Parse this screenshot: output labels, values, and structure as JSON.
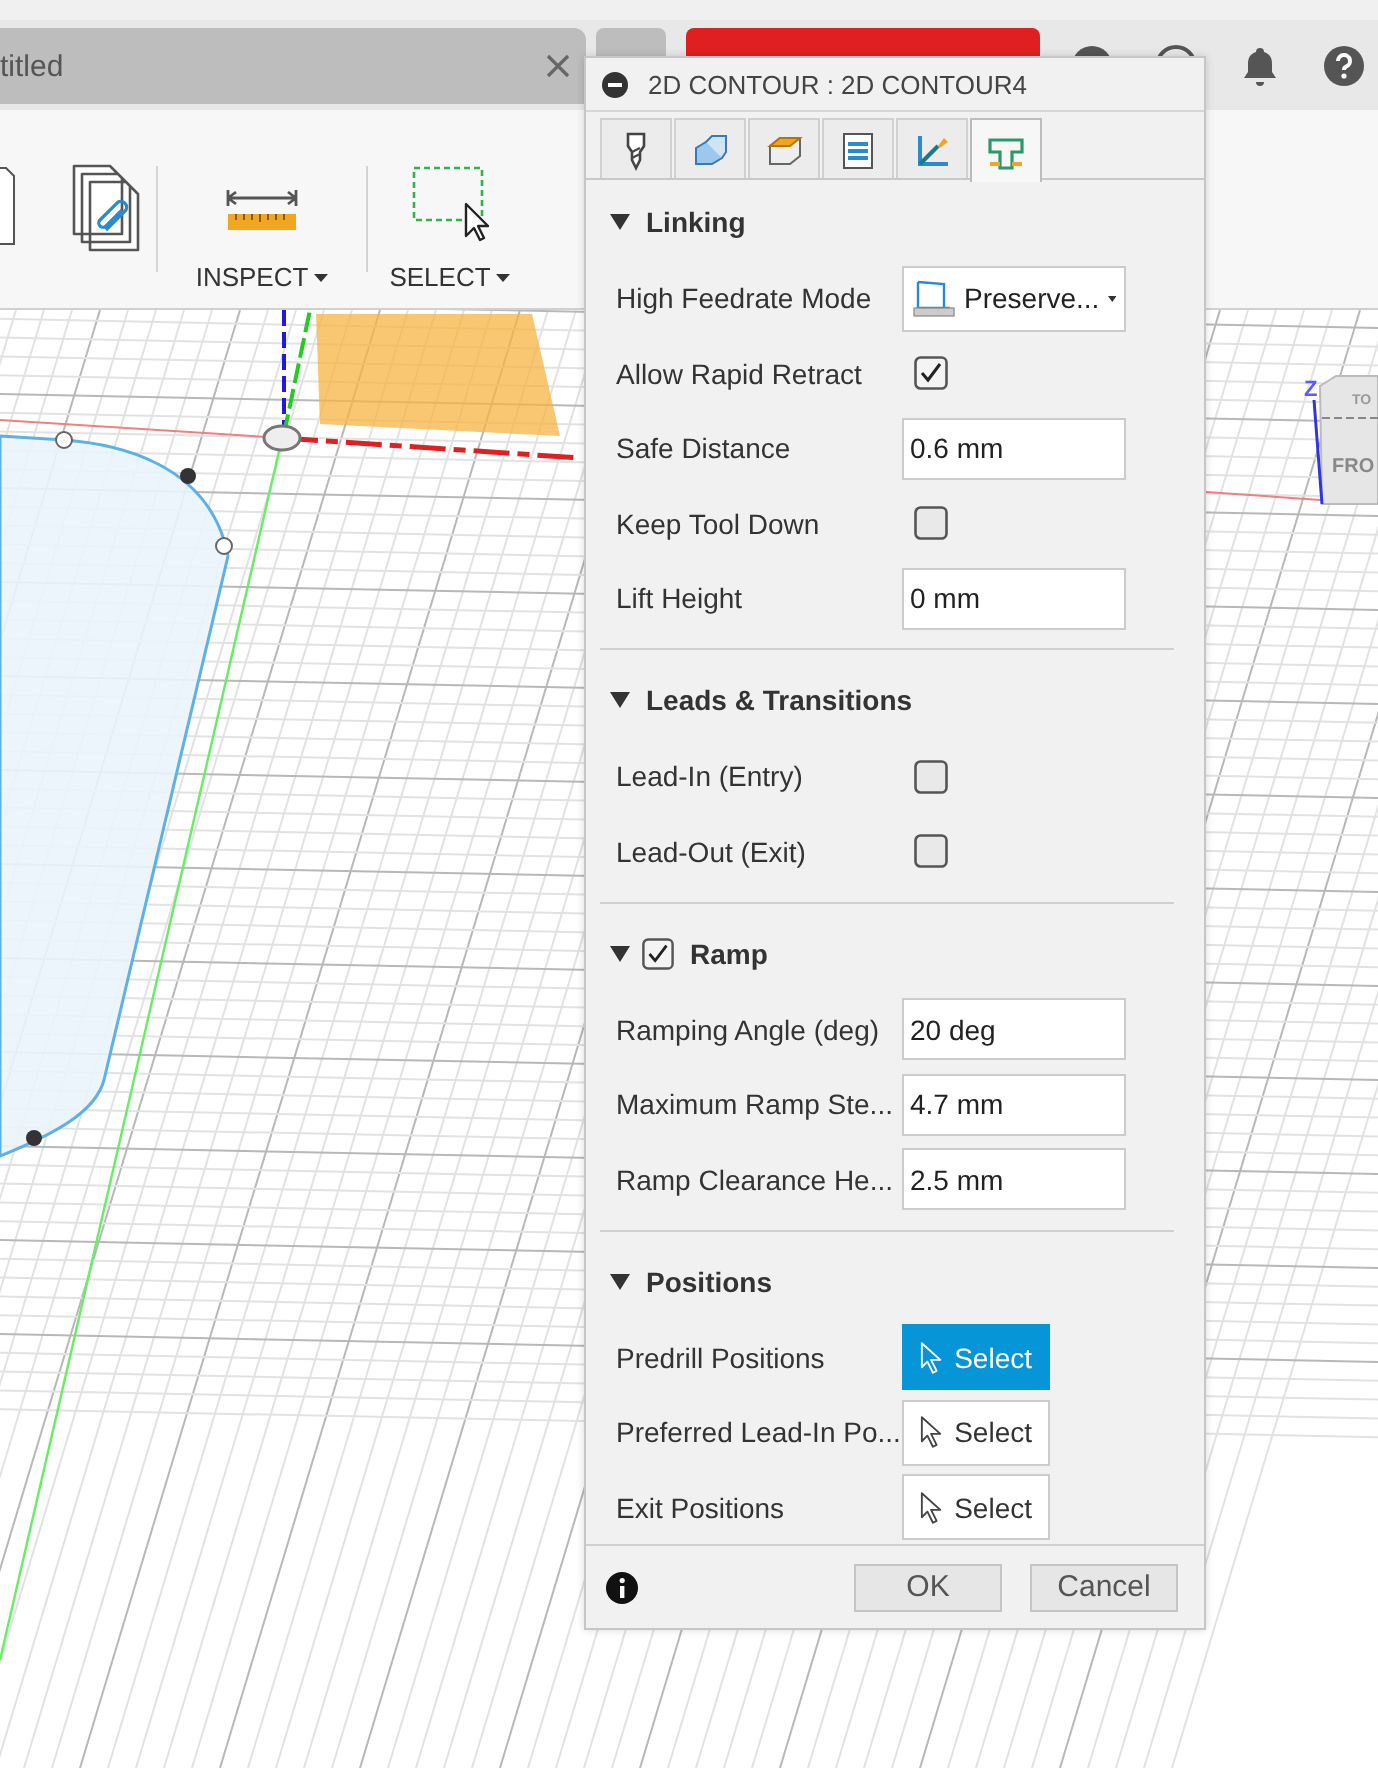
{
  "document_tab": {
    "title": "titled"
  },
  "toolbar": {
    "groups": [
      {
        "label": "INSPECT"
      },
      {
        "label": "SELECT"
      }
    ]
  },
  "viewport": {
    "view_cube": {
      "top": "TO",
      "front": "FRO",
      "axis": "Z"
    }
  },
  "dialog": {
    "title": "2D CONTOUR : 2D CONTOUR4",
    "tabs": [
      {
        "selected": false
      },
      {
        "selected": false
      },
      {
        "selected": false
      },
      {
        "selected": false
      },
      {
        "selected": false
      },
      {
        "selected": true
      }
    ],
    "sections": [
      {
        "title": "Linking",
        "expanded": true,
        "rows": [
          {
            "kind": "dropdown",
            "label": "High Feedrate Mode",
            "value": "Preserve..."
          },
          {
            "kind": "checkbox",
            "label": "Allow Rapid Retract",
            "checked": true
          },
          {
            "kind": "field",
            "label": "Safe Distance",
            "value": "0.6 mm"
          },
          {
            "kind": "checkbox",
            "label": "Keep Tool Down",
            "checked": false
          },
          {
            "kind": "field",
            "label": "Lift Height",
            "value": "0 mm"
          }
        ]
      },
      {
        "title": "Leads & Transitions",
        "expanded": true,
        "rows": [
          {
            "kind": "checkbox",
            "label": "Lead-In (Entry)",
            "checked": false
          },
          {
            "kind": "checkbox",
            "label": "Lead-Out (Exit)",
            "checked": false
          }
        ]
      },
      {
        "title": "Ramp",
        "expanded": true,
        "checked": true,
        "rows": [
          {
            "kind": "field",
            "label": "Ramping Angle (deg)",
            "value": "20 deg"
          },
          {
            "kind": "field",
            "label": "Maximum Ramp Ste...",
            "value": "4.7 mm"
          },
          {
            "kind": "field",
            "label": "Ramp Clearance He...",
            "value": "2.5 mm"
          }
        ]
      },
      {
        "title": "Positions",
        "expanded": true,
        "rows": [
          {
            "kind": "select",
            "label": "Predrill Positions",
            "button": "Select",
            "selected": true
          },
          {
            "kind": "select",
            "label": "Preferred Lead-In Po...",
            "button": "Select",
            "selected": false
          },
          {
            "kind": "select",
            "label": "Exit Positions",
            "button": "Select",
            "selected": false
          }
        ]
      }
    ],
    "buttons": [
      {
        "label": "OK"
      },
      {
        "label": "Cancel"
      }
    ]
  }
}
